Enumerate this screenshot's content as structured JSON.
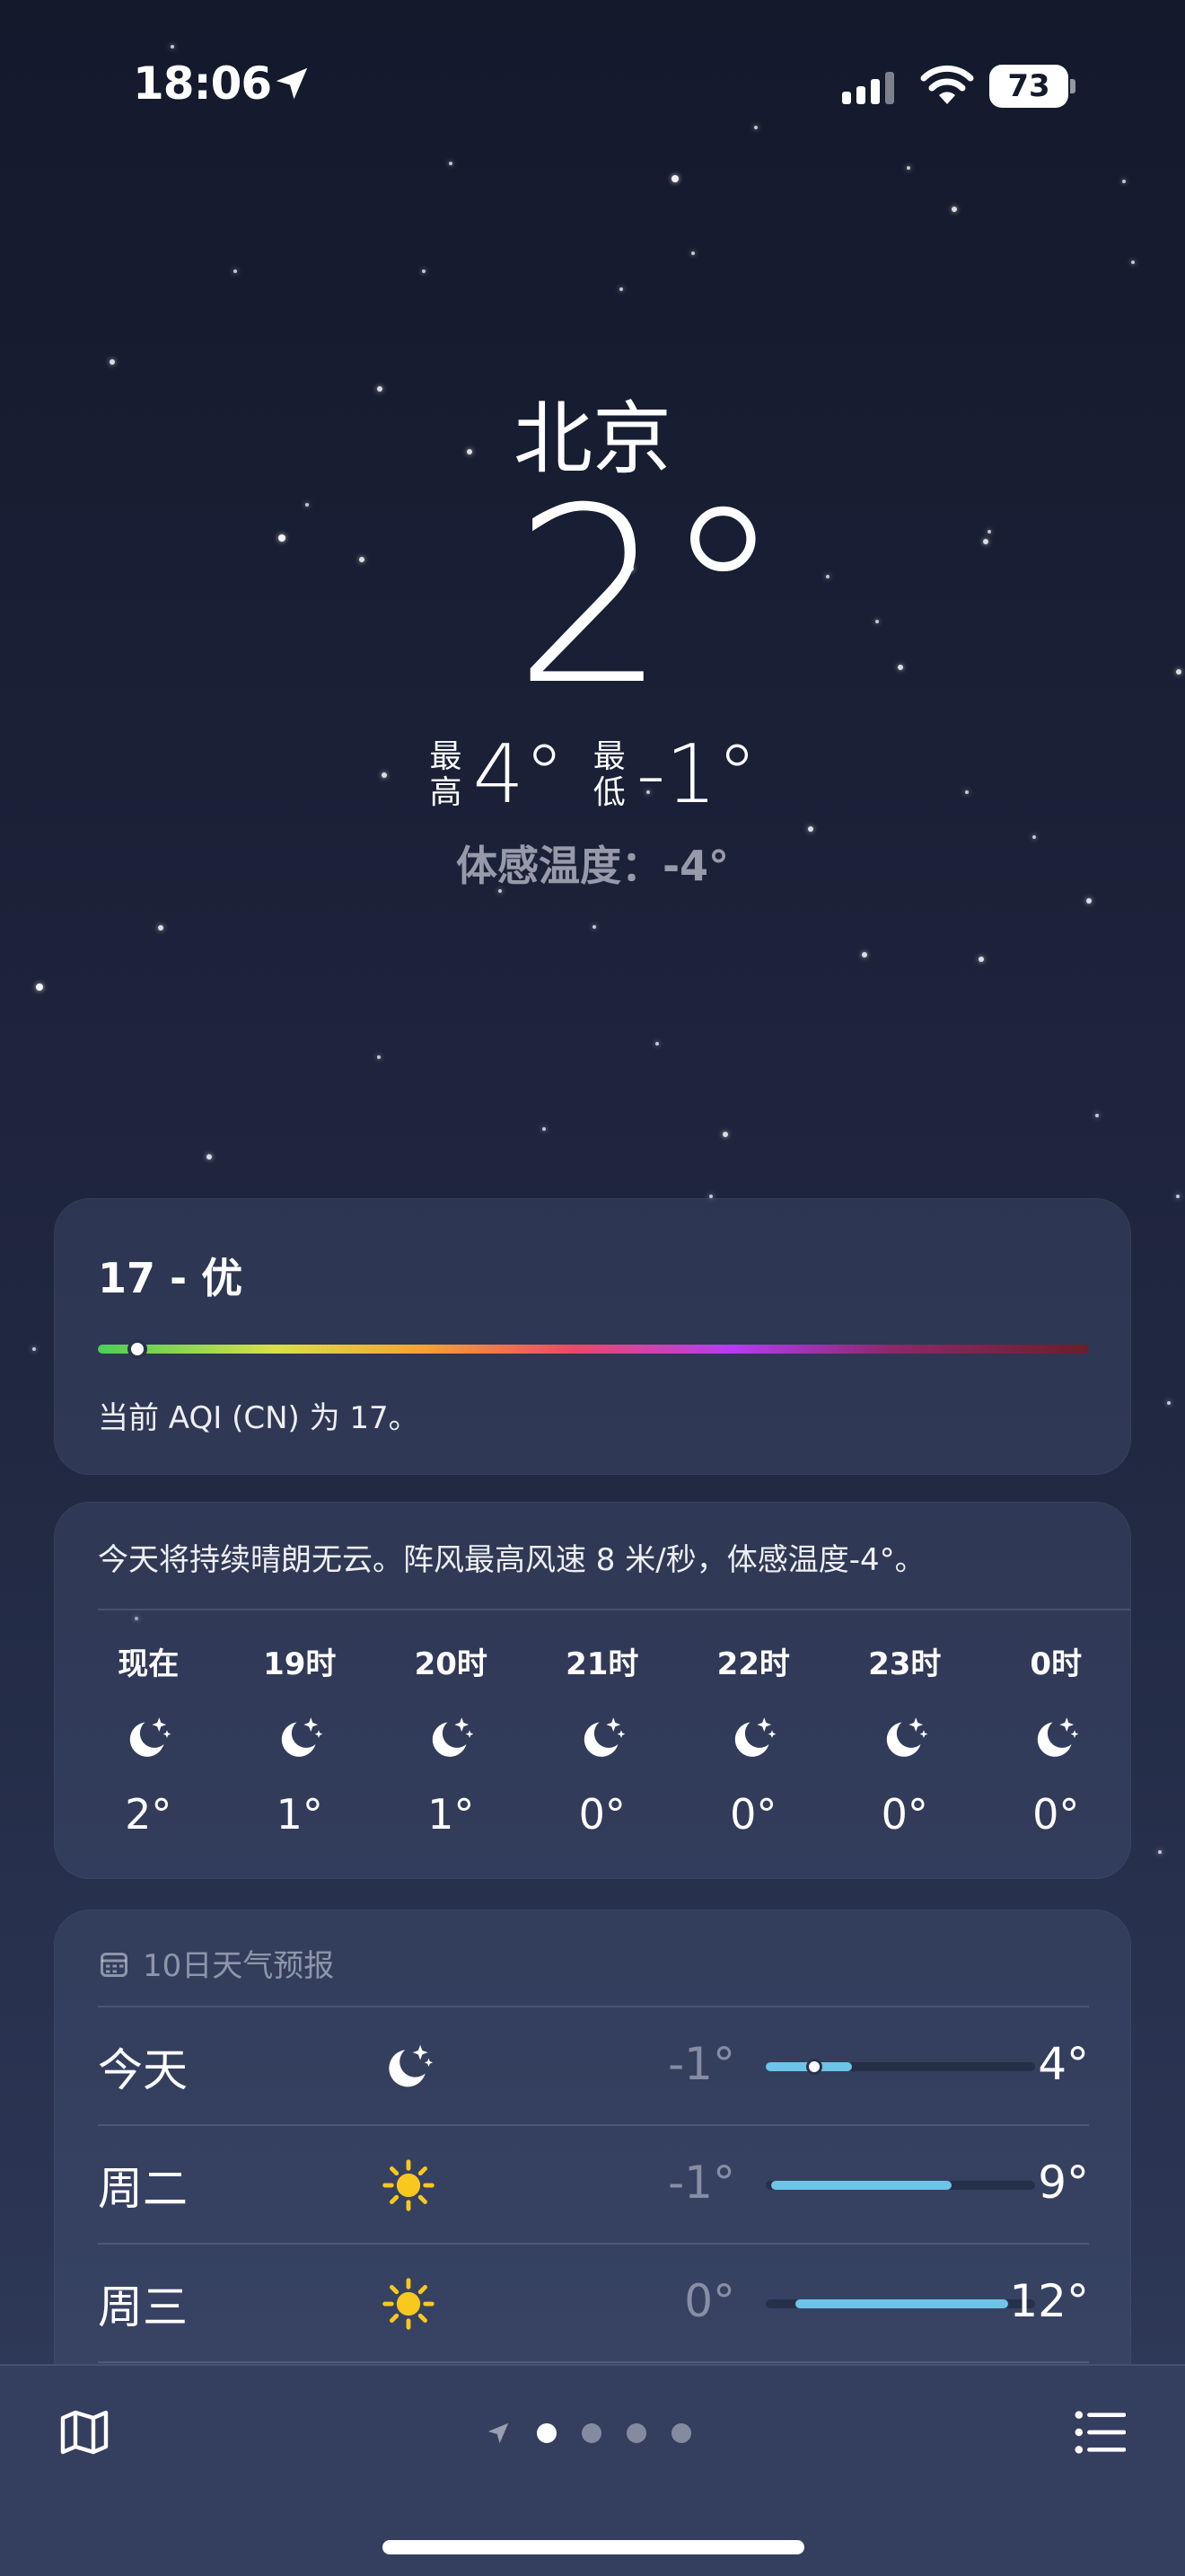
{
  "status_bar": {
    "time": "18:06",
    "battery": "73"
  },
  "hero": {
    "city": "北京",
    "temperature": "2°",
    "high_label": "最高",
    "high_value": "4°",
    "low_label": "最低",
    "low_value": "-1°",
    "feels_like": "体感温度：-4°"
  },
  "aqi": {
    "title": "17 - 优",
    "description": "当前 AQI (CN) 为 17。",
    "value_fraction": 0.04
  },
  "hourly": {
    "summary": "今天将持续晴朗无云。阵风最高风速 8 米/秒，体感温度-4°。",
    "hours": [
      {
        "time": "现在",
        "icon": "moon-stars-icon",
        "temp": "2°"
      },
      {
        "time": "19时",
        "icon": "moon-stars-icon",
        "temp": "1°"
      },
      {
        "time": "20时",
        "icon": "moon-stars-icon",
        "temp": "1°"
      },
      {
        "time": "21时",
        "icon": "moon-stars-icon",
        "temp": "0°"
      },
      {
        "time": "22时",
        "icon": "moon-stars-icon",
        "temp": "0°"
      },
      {
        "time": "23时",
        "icon": "moon-stars-icon",
        "temp": "0°"
      },
      {
        "time": "0时",
        "icon": "moon-stars-icon",
        "temp": "0°"
      }
    ]
  },
  "daily": {
    "header": "10日天气预报",
    "days": [
      {
        "name": "今天",
        "icon": "moon-stars-icon",
        "low": "-1°",
        "high": "4°",
        "bar_start": 0.0,
        "bar_end": 0.32,
        "current": 0.18
      },
      {
        "name": "周二",
        "icon": "sun-icon",
        "low": "-1°",
        "high": "9°",
        "bar_start": 0.02,
        "bar_end": 0.69
      },
      {
        "name": "周三",
        "icon": "sun-icon",
        "low": "0°",
        "high": "12°",
        "bar_start": 0.11,
        "bar_end": 0.9
      }
    ]
  },
  "pager": {
    "pages": 4,
    "active": 0
  },
  "colors": {
    "bar_fill": "#6ec3e8",
    "sun": "#f9c81e"
  }
}
